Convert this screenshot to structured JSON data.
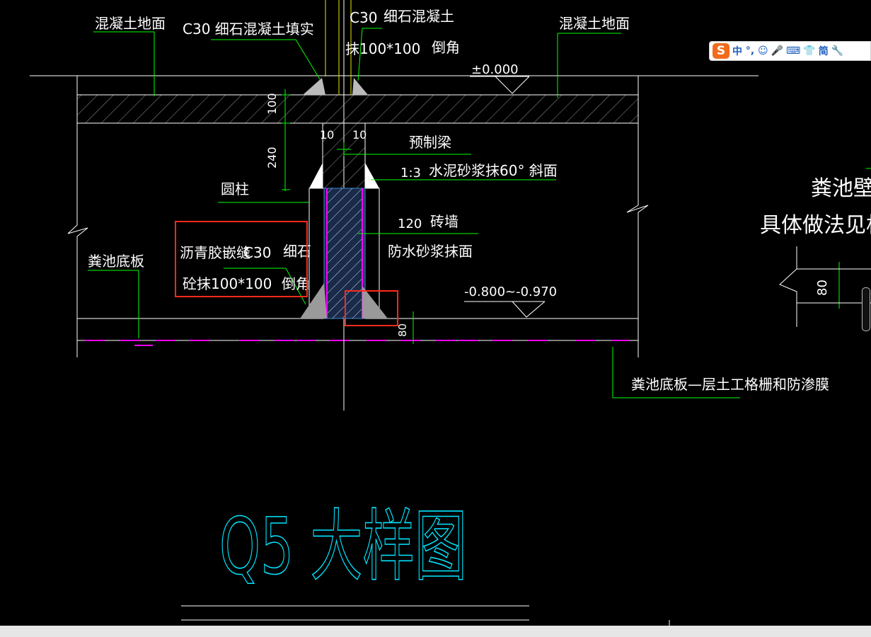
{
  "title": "Q5 大样图",
  "labels": {
    "ground_left": "混凝土地面",
    "ground_right": "混凝土地面",
    "c30_fill_left": "C30  细石混凝土填实",
    "c30_top": "C30",
    "fine_stone_concrete": "细石混凝土",
    "plaster_100x100": "抹100*100",
    "chamfer_top": "倒角",
    "elevation_zero": "±0.000",
    "dim_100": "100",
    "dim_240": "240",
    "dim_10_left": "10",
    "dim_10_right": "10",
    "precast_beam": "预制梁",
    "mortar_ratio": "1:3",
    "cement_mortar_slope": "水泥砂浆抹60° 斜面",
    "round_column": "圆柱",
    "brick_wall_120": "120",
    "brick_wall": "砖墙",
    "waterproof_mortar": "防水砂浆抹面",
    "asphalt_joint": "沥青胶嵌缝",
    "c30_bottom": "C30",
    "fine_stone_bottom": "细石",
    "concrete_plaster_100x100": "砼抹100*100",
    "chamfer_bottom": "倒角",
    "elevation_bottom": "-0.800~-0.970",
    "dim_80": "80",
    "tank_bottom_slab": "粪池底板",
    "geogrid_membrane_note": "粪池底板—层土工格栅和防渗膜",
    "tank_wall": "粪池壁",
    "see_relevant_method": "具体做法见相",
    "dim_80_right": "80"
  },
  "ime_toolbar": {
    "logo": "S",
    "mode": "中",
    "punct": "°,",
    "emoji": "☺",
    "voice": "🎤",
    "keyboard": "⌨",
    "skin": "👕",
    "simplified": "简",
    "settings": "🔧"
  },
  "colors": {
    "background": "#000000",
    "text": "#ffffff",
    "leader": "#00ff00",
    "title": "#00e5ff",
    "highlight": "#ff2a1a",
    "column_fill": "#3a8bd6",
    "magenta": "#ff00ff"
  }
}
